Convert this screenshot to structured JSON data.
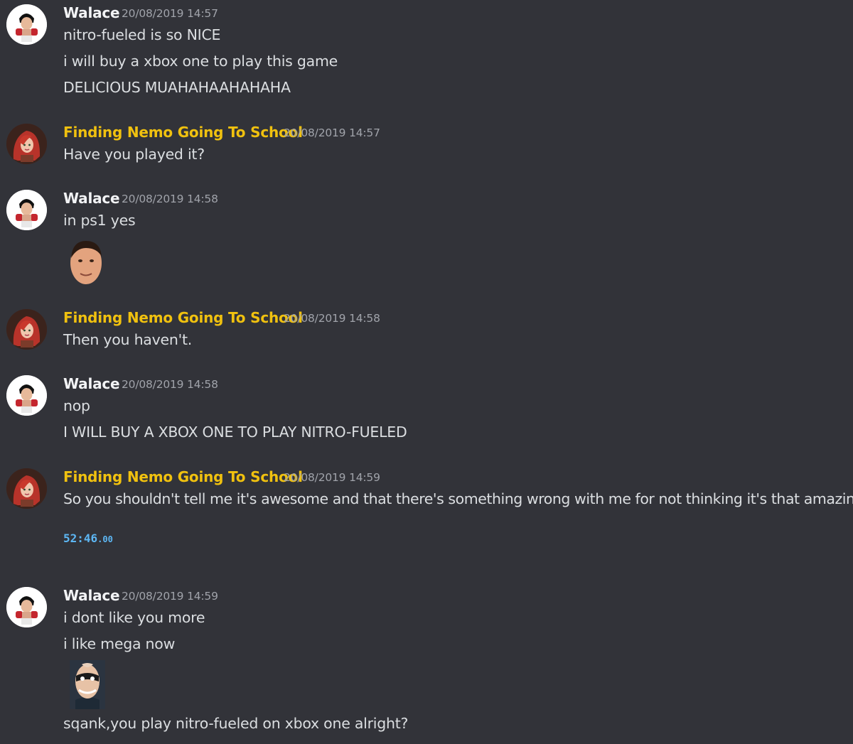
{
  "users": {
    "walace": {
      "name": "Walace",
      "color": "#f2f3f5"
    },
    "nemo": {
      "name": "Finding Nemo Going To School",
      "color": "#f0c10f"
    }
  },
  "messages": [
    {
      "author": "Walace",
      "timestamp": "20/08/2019 14:57",
      "lines": [
        "nitro-fueled is so NICE",
        "i will buy a xbox one to play this game",
        "DELICIOUS MUAHAHAAHAHAHA"
      ]
    },
    {
      "author": "Finding Nemo Going To School",
      "timestamp": "20/08/2019 14:57",
      "lines": [
        "Have you played it?"
      ]
    },
    {
      "author": "Walace",
      "timestamp": "20/08/2019 14:58",
      "lines": [
        "in ps1 yes"
      ],
      "emoji": "round-face-emoji"
    },
    {
      "author": "Finding Nemo Going To School",
      "timestamp": "20/08/2019 14:58",
      "lines": [
        "Then you haven't."
      ]
    },
    {
      "author": "Walace",
      "timestamp": "20/08/2019 14:58",
      "lines": [
        "nop",
        "I WILL BUY A XBOX ONE TO PLAY NITRO-FUELED"
      ]
    },
    {
      "author": "Finding Nemo Going To School",
      "timestamp": "20/08/2019 14:59",
      "lines": [
        "So you shouldn't tell me it's awesome and that there's something wrong with me for not thinking it's that amazing."
      ],
      "timer": {
        "main": "52:46",
        "fraction": ".00"
      }
    },
    {
      "author": "Walace",
      "timestamp": "20/08/2019 14:59",
      "lines": [
        "i dont like you more",
        "i like mega now",
        "sqank,you play nitro-fueled on xbox one alright?"
      ],
      "emoji": "mr-incredible-emoji"
    }
  ]
}
